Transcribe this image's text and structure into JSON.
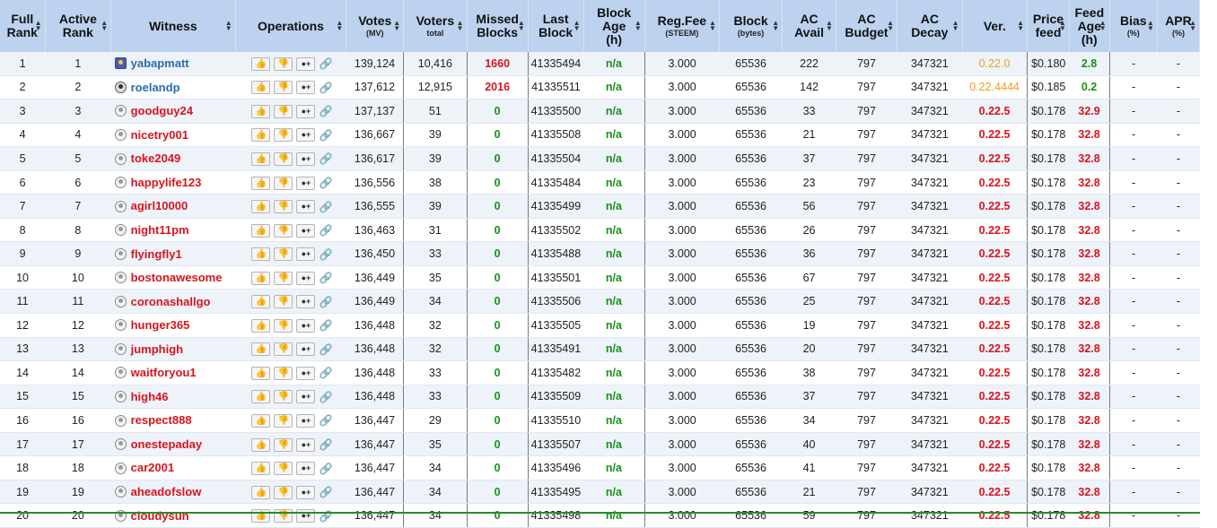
{
  "headers": {
    "full_rank": [
      "Full",
      "Rank"
    ],
    "active_rank": [
      "Active",
      "Rank"
    ],
    "witness": "Witness",
    "operations": "Operations",
    "votes": "Votes",
    "votes_sub": "(MV)",
    "voters": "Voters",
    "voters_sub": "total",
    "missed": [
      "Missed",
      "Blocks"
    ],
    "last_block": [
      "Last",
      "Block"
    ],
    "block_age": [
      "Block",
      "Age",
      "(h)"
    ],
    "reg_fee": "Reg.Fee",
    "reg_fee_sub": "(STEEM)",
    "block": "Block",
    "block_sub": "(bytes)",
    "ac_avail": [
      "AC",
      "Avail"
    ],
    "ac_budget": [
      "AC",
      "Budget"
    ],
    "ac_decay": [
      "AC",
      "Decay"
    ],
    "ver": "Ver.",
    "price_feed": [
      "Price",
      "feed"
    ],
    "feed_age": [
      "Feed",
      "Age",
      "(h)"
    ],
    "bias": "Bias",
    "bias_sub": "(%)",
    "apr": "APR",
    "apr_sub": "(%)"
  },
  "icons": {
    "upvote": "thumbs-up-icon",
    "downvote": "thumbs-down-icon",
    "add_proxy": "add-user-icon",
    "link": "link-icon",
    "sort": "sort-arrows-icon"
  },
  "colors": {
    "header_bg": "#bcd2ee",
    "row_alt": "#eef3fa",
    "red": "#d8141c",
    "green": "#1a8f1a",
    "orange": "#f0a020",
    "blue": "#2b6cb0"
  },
  "rows": [
    {
      "full": "1",
      "active": "1",
      "name": "yabapmatt",
      "avatar": "pic1",
      "name_color": "blue",
      "votes": "139,124",
      "voters": "10,416",
      "missed": "1660",
      "missed_color": "red",
      "last": "41335494",
      "age": "n/a",
      "fee": "3.000",
      "block": "65536",
      "avail": "222",
      "budget": "797",
      "decay": "347321",
      "ver": "0.22.0",
      "ver_color": "orange",
      "price": "$0.180",
      "feed_age": "2.8",
      "feed_color": "green",
      "bias": "-",
      "apr": "-"
    },
    {
      "full": "2",
      "active": "2",
      "name": "roelandp",
      "avatar": "pic2",
      "name_color": "blue",
      "votes": "137,612",
      "voters": "12,915",
      "missed": "2016",
      "missed_color": "red",
      "last": "41335511",
      "age": "n/a",
      "fee": "3.000",
      "block": "65536",
      "avail": "142",
      "budget": "797",
      "decay": "347321",
      "ver": "0.22.4444",
      "ver_color": "orange",
      "price": "$0.185",
      "feed_age": "0.2",
      "feed_color": "green",
      "bias": "-",
      "apr": "-"
    },
    {
      "full": "3",
      "active": "3",
      "name": "goodguy24",
      "avatar": "default",
      "name_color": "red",
      "votes": "137,137",
      "voters": "51",
      "missed": "0",
      "missed_color": "green",
      "last": "41335500",
      "age": "n/a",
      "fee": "3.000",
      "block": "65536",
      "avail": "33",
      "budget": "797",
      "decay": "347321",
      "ver": "0.22.5",
      "ver_color": "red",
      "price": "$0.178",
      "feed_age": "32.9",
      "feed_color": "red",
      "bias": "-",
      "apr": "-"
    },
    {
      "full": "4",
      "active": "4",
      "name": "nicetry001",
      "avatar": "default",
      "name_color": "red",
      "votes": "136,667",
      "voters": "39",
      "missed": "0",
      "missed_color": "green",
      "last": "41335508",
      "age": "n/a",
      "fee": "3.000",
      "block": "65536",
      "avail": "21",
      "budget": "797",
      "decay": "347321",
      "ver": "0.22.5",
      "ver_color": "red",
      "price": "$0.178",
      "feed_age": "32.8",
      "feed_color": "red",
      "bias": "-",
      "apr": "-"
    },
    {
      "full": "5",
      "active": "5",
      "name": "toke2049",
      "avatar": "default",
      "name_color": "red",
      "votes": "136,617",
      "voters": "39",
      "missed": "0",
      "missed_color": "green",
      "last": "41335504",
      "age": "n/a",
      "fee": "3.000",
      "block": "65536",
      "avail": "37",
      "budget": "797",
      "decay": "347321",
      "ver": "0.22.5",
      "ver_color": "red",
      "price": "$0.178",
      "feed_age": "32.8",
      "feed_color": "red",
      "bias": "-",
      "apr": "-"
    },
    {
      "full": "6",
      "active": "6",
      "name": "happylife123",
      "avatar": "default",
      "name_color": "red",
      "votes": "136,556",
      "voters": "38",
      "missed": "0",
      "missed_color": "green",
      "last": "41335484",
      "age": "n/a",
      "fee": "3.000",
      "block": "65536",
      "avail": "23",
      "budget": "797",
      "decay": "347321",
      "ver": "0.22.5",
      "ver_color": "red",
      "price": "$0.178",
      "feed_age": "32.8",
      "feed_color": "red",
      "bias": "-",
      "apr": "-"
    },
    {
      "full": "7",
      "active": "7",
      "name": "agirl10000",
      "avatar": "default",
      "name_color": "red",
      "votes": "136,555",
      "voters": "39",
      "missed": "0",
      "missed_color": "green",
      "last": "41335499",
      "age": "n/a",
      "fee": "3.000",
      "block": "65536",
      "avail": "56",
      "budget": "797",
      "decay": "347321",
      "ver": "0.22.5",
      "ver_color": "red",
      "price": "$0.178",
      "feed_age": "32.8",
      "feed_color": "red",
      "bias": "-",
      "apr": "-"
    },
    {
      "full": "8",
      "active": "8",
      "name": "night11pm",
      "avatar": "default",
      "name_color": "red",
      "votes": "136,463",
      "voters": "31",
      "missed": "0",
      "missed_color": "green",
      "last": "41335502",
      "age": "n/a",
      "fee": "3.000",
      "block": "65536",
      "avail": "26",
      "budget": "797",
      "decay": "347321",
      "ver": "0.22.5",
      "ver_color": "red",
      "price": "$0.178",
      "feed_age": "32.8",
      "feed_color": "red",
      "bias": "-",
      "apr": "-"
    },
    {
      "full": "9",
      "active": "9",
      "name": "flyingfly1",
      "avatar": "default",
      "name_color": "red",
      "votes": "136,450",
      "voters": "33",
      "missed": "0",
      "missed_color": "green",
      "last": "41335488",
      "age": "n/a",
      "fee": "3.000",
      "block": "65536",
      "avail": "36",
      "budget": "797",
      "decay": "347321",
      "ver": "0.22.5",
      "ver_color": "red",
      "price": "$0.178",
      "feed_age": "32.8",
      "feed_color": "red",
      "bias": "-",
      "apr": "-"
    },
    {
      "full": "10",
      "active": "10",
      "name": "bostonawesome",
      "avatar": "default",
      "name_color": "red",
      "votes": "136,449",
      "voters": "35",
      "missed": "0",
      "missed_color": "green",
      "last": "41335501",
      "age": "n/a",
      "fee": "3.000",
      "block": "65536",
      "avail": "67",
      "budget": "797",
      "decay": "347321",
      "ver": "0.22.5",
      "ver_color": "red",
      "price": "$0.178",
      "feed_age": "32.8",
      "feed_color": "red",
      "bias": "-",
      "apr": "-"
    },
    {
      "full": "11",
      "active": "11",
      "name": "coronashallgo",
      "avatar": "default",
      "name_color": "red",
      "votes": "136,449",
      "voters": "34",
      "missed": "0",
      "missed_color": "green",
      "last": "41335506",
      "age": "n/a",
      "fee": "3.000",
      "block": "65536",
      "avail": "25",
      "budget": "797",
      "decay": "347321",
      "ver": "0.22.5",
      "ver_color": "red",
      "price": "$0.178",
      "feed_age": "32.8",
      "feed_color": "red",
      "bias": "-",
      "apr": "-"
    },
    {
      "full": "12",
      "active": "12",
      "name": "hunger365",
      "avatar": "default",
      "name_color": "red",
      "votes": "136,448",
      "voters": "32",
      "missed": "0",
      "missed_color": "green",
      "last": "41335505",
      "age": "n/a",
      "fee": "3.000",
      "block": "65536",
      "avail": "19",
      "budget": "797",
      "decay": "347321",
      "ver": "0.22.5",
      "ver_color": "red",
      "price": "$0.178",
      "feed_age": "32.8",
      "feed_color": "red",
      "bias": "-",
      "apr": "-"
    },
    {
      "full": "13",
      "active": "13",
      "name": "jumphigh",
      "avatar": "default",
      "name_color": "red",
      "votes": "136,448",
      "voters": "32",
      "missed": "0",
      "missed_color": "green",
      "last": "41335491",
      "age": "n/a",
      "fee": "3.000",
      "block": "65536",
      "avail": "20",
      "budget": "797",
      "decay": "347321",
      "ver": "0.22.5",
      "ver_color": "red",
      "price": "$0.178",
      "feed_age": "32.8",
      "feed_color": "red",
      "bias": "-",
      "apr": "-"
    },
    {
      "full": "14",
      "active": "14",
      "name": "waitforyou1",
      "avatar": "default",
      "name_color": "red",
      "votes": "136,448",
      "voters": "33",
      "missed": "0",
      "missed_color": "green",
      "last": "41335482",
      "age": "n/a",
      "fee": "3.000",
      "block": "65536",
      "avail": "38",
      "budget": "797",
      "decay": "347321",
      "ver": "0.22.5",
      "ver_color": "red",
      "price": "$0.178",
      "feed_age": "32.8",
      "feed_color": "red",
      "bias": "-",
      "apr": "-"
    },
    {
      "full": "15",
      "active": "15",
      "name": "high46",
      "avatar": "default",
      "name_color": "red",
      "votes": "136,448",
      "voters": "33",
      "missed": "0",
      "missed_color": "green",
      "last": "41335509",
      "age": "n/a",
      "fee": "3.000",
      "block": "65536",
      "avail": "37",
      "budget": "797",
      "decay": "347321",
      "ver": "0.22.5",
      "ver_color": "red",
      "price": "$0.178",
      "feed_age": "32.8",
      "feed_color": "red",
      "bias": "-",
      "apr": "-"
    },
    {
      "full": "16",
      "active": "16",
      "name": "respect888",
      "avatar": "default",
      "name_color": "red",
      "votes": "136,447",
      "voters": "29",
      "missed": "0",
      "missed_color": "green",
      "last": "41335510",
      "age": "n/a",
      "fee": "3.000",
      "block": "65536",
      "avail": "34",
      "budget": "797",
      "decay": "347321",
      "ver": "0.22.5",
      "ver_color": "red",
      "price": "$0.178",
      "feed_age": "32.8",
      "feed_color": "red",
      "bias": "-",
      "apr": "-"
    },
    {
      "full": "17",
      "active": "17",
      "name": "onestepaday",
      "avatar": "default",
      "name_color": "red",
      "votes": "136,447",
      "voters": "35",
      "missed": "0",
      "missed_color": "green",
      "last": "41335507",
      "age": "n/a",
      "fee": "3.000",
      "block": "65536",
      "avail": "40",
      "budget": "797",
      "decay": "347321",
      "ver": "0.22.5",
      "ver_color": "red",
      "price": "$0.178",
      "feed_age": "32.8",
      "feed_color": "red",
      "bias": "-",
      "apr": "-"
    },
    {
      "full": "18",
      "active": "18",
      "name": "car2001",
      "avatar": "default",
      "name_color": "red",
      "votes": "136,447",
      "voters": "34",
      "missed": "0",
      "missed_color": "green",
      "last": "41335496",
      "age": "n/a",
      "fee": "3.000",
      "block": "65536",
      "avail": "41",
      "budget": "797",
      "decay": "347321",
      "ver": "0.22.5",
      "ver_color": "red",
      "price": "$0.178",
      "feed_age": "32.8",
      "feed_color": "red",
      "bias": "-",
      "apr": "-"
    },
    {
      "full": "19",
      "active": "19",
      "name": "aheadofslow",
      "avatar": "default",
      "name_color": "red",
      "votes": "136,447",
      "voters": "34",
      "missed": "0",
      "missed_color": "green",
      "last": "41335495",
      "age": "n/a",
      "fee": "3.000",
      "block": "65536",
      "avail": "21",
      "budget": "797",
      "decay": "347321",
      "ver": "0.22.5",
      "ver_color": "red",
      "price": "$0.178",
      "feed_age": "32.8",
      "feed_color": "red",
      "bias": "-",
      "apr": "-"
    },
    {
      "full": "20",
      "active": "20",
      "name": "cloudysun",
      "avatar": "default",
      "name_color": "red",
      "votes": "136,447",
      "voters": "34",
      "missed": "0",
      "missed_color": "green",
      "last": "41335498",
      "age": "n/a",
      "fee": "3.000",
      "block": "65536",
      "avail": "59",
      "budget": "797",
      "decay": "347321",
      "ver": "0.22.5",
      "ver_color": "red",
      "price": "$0.178",
      "feed_age": "32.8",
      "feed_color": "red",
      "bias": "-",
      "apr": "-"
    }
  ]
}
